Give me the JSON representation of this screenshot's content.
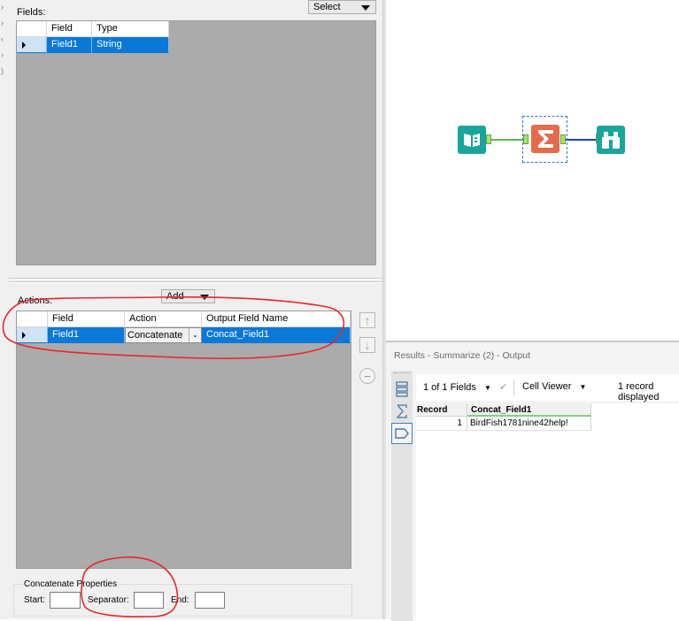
{
  "config": {
    "fields_label": "Fields:",
    "select_dropdown": "Select",
    "fields_grid": {
      "headers": [
        "Field",
        "Type"
      ],
      "rows": [
        {
          "field": "Field1",
          "type": "String"
        }
      ]
    },
    "actions_label": "Actions:",
    "add_dropdown": "Add",
    "actions_grid": {
      "headers": [
        "Field",
        "Action",
        "Output Field Name"
      ],
      "rows": [
        {
          "field": "Field1",
          "action": "Concatenate",
          "output": "Concat_Field1"
        }
      ]
    },
    "concat": {
      "group_label": "Concatenate Properties",
      "start_label": "Start:",
      "start_value": "",
      "separator_label": "Separator:",
      "separator_value": "",
      "end_label": "End:",
      "end_value": ""
    }
  },
  "workflow": {
    "tools": [
      {
        "name": "input-data-tool",
        "icon": "book-icon",
        "color": "#19a59b"
      },
      {
        "name": "summarize-tool",
        "icon": "sigma-icon",
        "color": "#e66a4c",
        "selected": true
      },
      {
        "name": "browse-tool",
        "icon": "binoculars-icon",
        "color": "#19a59b"
      }
    ]
  },
  "results": {
    "title": "Results - Summarize (2) - Output",
    "fields_count": "1 of 1 Fields",
    "viewer": "Cell Viewer",
    "records": "1 record displayed",
    "table": {
      "headers": [
        "Record",
        "Concat_Field1"
      ],
      "rows": [
        {
          "record": "1",
          "value": "BirdFish1781nine42help!"
        }
      ]
    }
  },
  "colors": {
    "selection": "#0a78d7",
    "grid_background": "#ababab",
    "annotation": "#e8262d"
  }
}
